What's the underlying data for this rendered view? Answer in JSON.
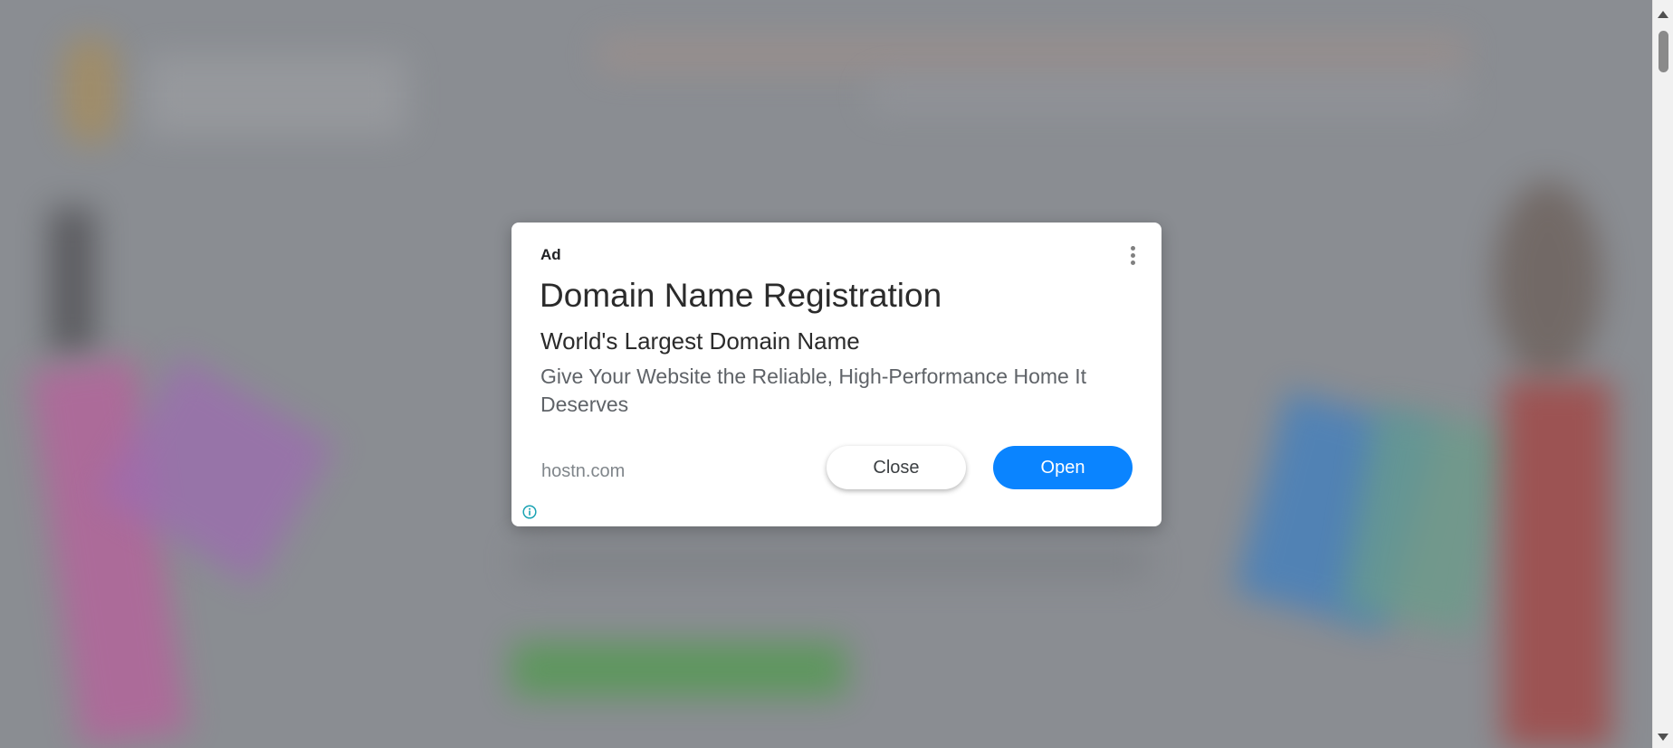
{
  "ad": {
    "label": "Ad",
    "headline": "Domain Name Registration",
    "subheadline": "World's Largest Domain Name",
    "description": "Give Your Website the Reliable, High-Performance Home It Deserves",
    "display_domain": "hostn.com",
    "close_label": "Close",
    "open_label": "Open",
    "menu_icon": "more-vert-icon",
    "info_icon": "info-icon"
  },
  "colors": {
    "open_button": "#0a84ff",
    "info_icon": "#1aa3b3",
    "overlay": "#8a8d92"
  }
}
